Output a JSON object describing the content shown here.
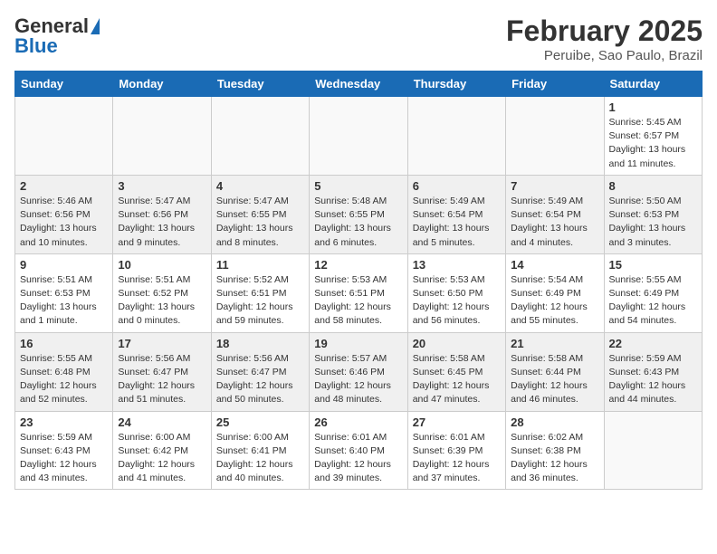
{
  "header": {
    "logo_general": "General",
    "logo_blue": "Blue",
    "month_title": "February 2025",
    "location": "Peruibe, Sao Paulo, Brazil"
  },
  "weekdays": [
    "Sunday",
    "Monday",
    "Tuesday",
    "Wednesday",
    "Thursday",
    "Friday",
    "Saturday"
  ],
  "weeks": [
    [
      {
        "day": "",
        "info": ""
      },
      {
        "day": "",
        "info": ""
      },
      {
        "day": "",
        "info": ""
      },
      {
        "day": "",
        "info": ""
      },
      {
        "day": "",
        "info": ""
      },
      {
        "day": "",
        "info": ""
      },
      {
        "day": "1",
        "info": "Sunrise: 5:45 AM\nSunset: 6:57 PM\nDaylight: 13 hours and 11 minutes."
      }
    ],
    [
      {
        "day": "2",
        "info": "Sunrise: 5:46 AM\nSunset: 6:56 PM\nDaylight: 13 hours and 10 minutes."
      },
      {
        "day": "3",
        "info": "Sunrise: 5:47 AM\nSunset: 6:56 PM\nDaylight: 13 hours and 9 minutes."
      },
      {
        "day": "4",
        "info": "Sunrise: 5:47 AM\nSunset: 6:55 PM\nDaylight: 13 hours and 8 minutes."
      },
      {
        "day": "5",
        "info": "Sunrise: 5:48 AM\nSunset: 6:55 PM\nDaylight: 13 hours and 6 minutes."
      },
      {
        "day": "6",
        "info": "Sunrise: 5:49 AM\nSunset: 6:54 PM\nDaylight: 13 hours and 5 minutes."
      },
      {
        "day": "7",
        "info": "Sunrise: 5:49 AM\nSunset: 6:54 PM\nDaylight: 13 hours and 4 minutes."
      },
      {
        "day": "8",
        "info": "Sunrise: 5:50 AM\nSunset: 6:53 PM\nDaylight: 13 hours and 3 minutes."
      }
    ],
    [
      {
        "day": "9",
        "info": "Sunrise: 5:51 AM\nSunset: 6:53 PM\nDaylight: 13 hours and 1 minute."
      },
      {
        "day": "10",
        "info": "Sunrise: 5:51 AM\nSunset: 6:52 PM\nDaylight: 13 hours and 0 minutes."
      },
      {
        "day": "11",
        "info": "Sunrise: 5:52 AM\nSunset: 6:51 PM\nDaylight: 12 hours and 59 minutes."
      },
      {
        "day": "12",
        "info": "Sunrise: 5:53 AM\nSunset: 6:51 PM\nDaylight: 12 hours and 58 minutes."
      },
      {
        "day": "13",
        "info": "Sunrise: 5:53 AM\nSunset: 6:50 PM\nDaylight: 12 hours and 56 minutes."
      },
      {
        "day": "14",
        "info": "Sunrise: 5:54 AM\nSunset: 6:49 PM\nDaylight: 12 hours and 55 minutes."
      },
      {
        "day": "15",
        "info": "Sunrise: 5:55 AM\nSunset: 6:49 PM\nDaylight: 12 hours and 54 minutes."
      }
    ],
    [
      {
        "day": "16",
        "info": "Sunrise: 5:55 AM\nSunset: 6:48 PM\nDaylight: 12 hours and 52 minutes."
      },
      {
        "day": "17",
        "info": "Sunrise: 5:56 AM\nSunset: 6:47 PM\nDaylight: 12 hours and 51 minutes."
      },
      {
        "day": "18",
        "info": "Sunrise: 5:56 AM\nSunset: 6:47 PM\nDaylight: 12 hours and 50 minutes."
      },
      {
        "day": "19",
        "info": "Sunrise: 5:57 AM\nSunset: 6:46 PM\nDaylight: 12 hours and 48 minutes."
      },
      {
        "day": "20",
        "info": "Sunrise: 5:58 AM\nSunset: 6:45 PM\nDaylight: 12 hours and 47 minutes."
      },
      {
        "day": "21",
        "info": "Sunrise: 5:58 AM\nSunset: 6:44 PM\nDaylight: 12 hours and 46 minutes."
      },
      {
        "day": "22",
        "info": "Sunrise: 5:59 AM\nSunset: 6:43 PM\nDaylight: 12 hours and 44 minutes."
      }
    ],
    [
      {
        "day": "23",
        "info": "Sunrise: 5:59 AM\nSunset: 6:43 PM\nDaylight: 12 hours and 43 minutes."
      },
      {
        "day": "24",
        "info": "Sunrise: 6:00 AM\nSunset: 6:42 PM\nDaylight: 12 hours and 41 minutes."
      },
      {
        "day": "25",
        "info": "Sunrise: 6:00 AM\nSunset: 6:41 PM\nDaylight: 12 hours and 40 minutes."
      },
      {
        "day": "26",
        "info": "Sunrise: 6:01 AM\nSunset: 6:40 PM\nDaylight: 12 hours and 39 minutes."
      },
      {
        "day": "27",
        "info": "Sunrise: 6:01 AM\nSunset: 6:39 PM\nDaylight: 12 hours and 37 minutes."
      },
      {
        "day": "28",
        "info": "Sunrise: 6:02 AM\nSunset: 6:38 PM\nDaylight: 12 hours and 36 minutes."
      },
      {
        "day": "",
        "info": ""
      }
    ]
  ]
}
